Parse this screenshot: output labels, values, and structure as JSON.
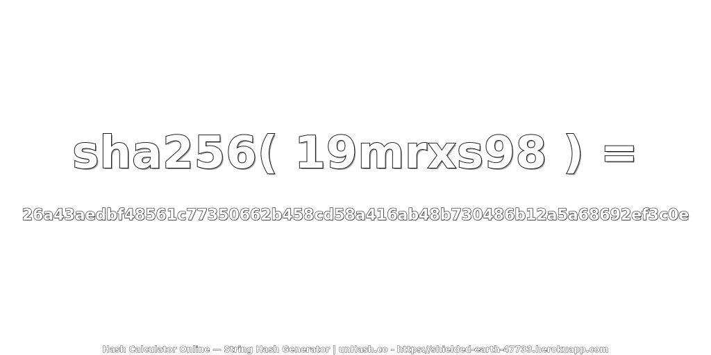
{
  "title": "sha256( 19mrxs98 ) =",
  "hash": "26a43aedbf48561c77350662b458cd58a416ab48b730486b12a5a68692ef3c0e",
  "footer": "Hash Calculator Online — String Hash Generator | unHash.co - https://shielded-earth-47733.herokuapp.com",
  "colors": {
    "background": "#ffffff",
    "text_fill": "#ffffff",
    "text_outline": "#1a1a1a"
  }
}
